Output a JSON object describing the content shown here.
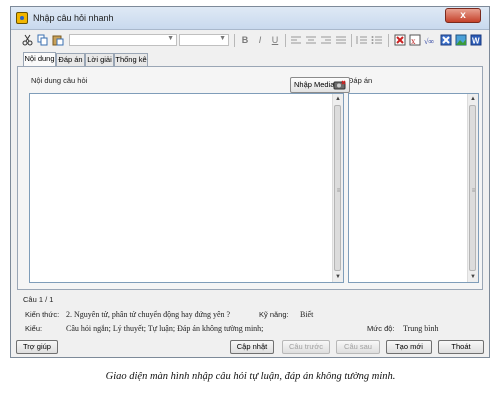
{
  "window": {
    "title": "Nhập câu hỏi nhanh",
    "close_label": "x"
  },
  "toolbar": {
    "icons": [
      "cut-icon",
      "copy-icon",
      "paste-icon",
      "font-combo",
      "size-combo",
      "bold-icon",
      "italic-icon",
      "underline-icon",
      "align-left-icon",
      "align-center-icon",
      "align-right-icon",
      "justify-icon",
      "numbered-list-icon",
      "bullet-list-icon",
      "insert-table-icon",
      "insert-symbol-icon",
      "insert-formula-icon",
      "remove-format-icon",
      "insert-image-icon",
      "word-import-icon"
    ],
    "bold": "B",
    "italic": "I",
    "underline": "U"
  },
  "tabs": [
    {
      "label": "Nội dung",
      "active": true
    },
    {
      "label": "Đáp án",
      "active": false
    },
    {
      "label": "Lời giải",
      "active": false
    },
    {
      "label": "Thống kê",
      "active": false
    }
  ],
  "content": {
    "question_label": "Nội dung câu hỏi",
    "media_button": "Nhập Media",
    "answer_label": "Đáp án"
  },
  "info": {
    "counter": "Câu 1 / 1",
    "knowledge_label": "Kiến thức:",
    "knowledge_value": "2. Nguyên tử, phân tử chuyển động hay đứng yên ?",
    "skill_label": "Kỹ năng:",
    "skill_value": "Biết",
    "type_label": "Kiểu:",
    "type_value": "Câu hỏi ngắn; Lý thuyết; Tự luận; Đáp án không tường minh;",
    "level_label": "Mức độ:",
    "level_value": "Trung bình"
  },
  "buttons": {
    "help": "Trợ giúp",
    "update": "Cập nhật",
    "previous": "Câu trước",
    "next": "Câu sau",
    "new": "Tạo mới",
    "exit": "Thoát"
  },
  "caption": "Giao diện màn hình nhập câu hỏi tự luận, đáp án không tường minh."
}
